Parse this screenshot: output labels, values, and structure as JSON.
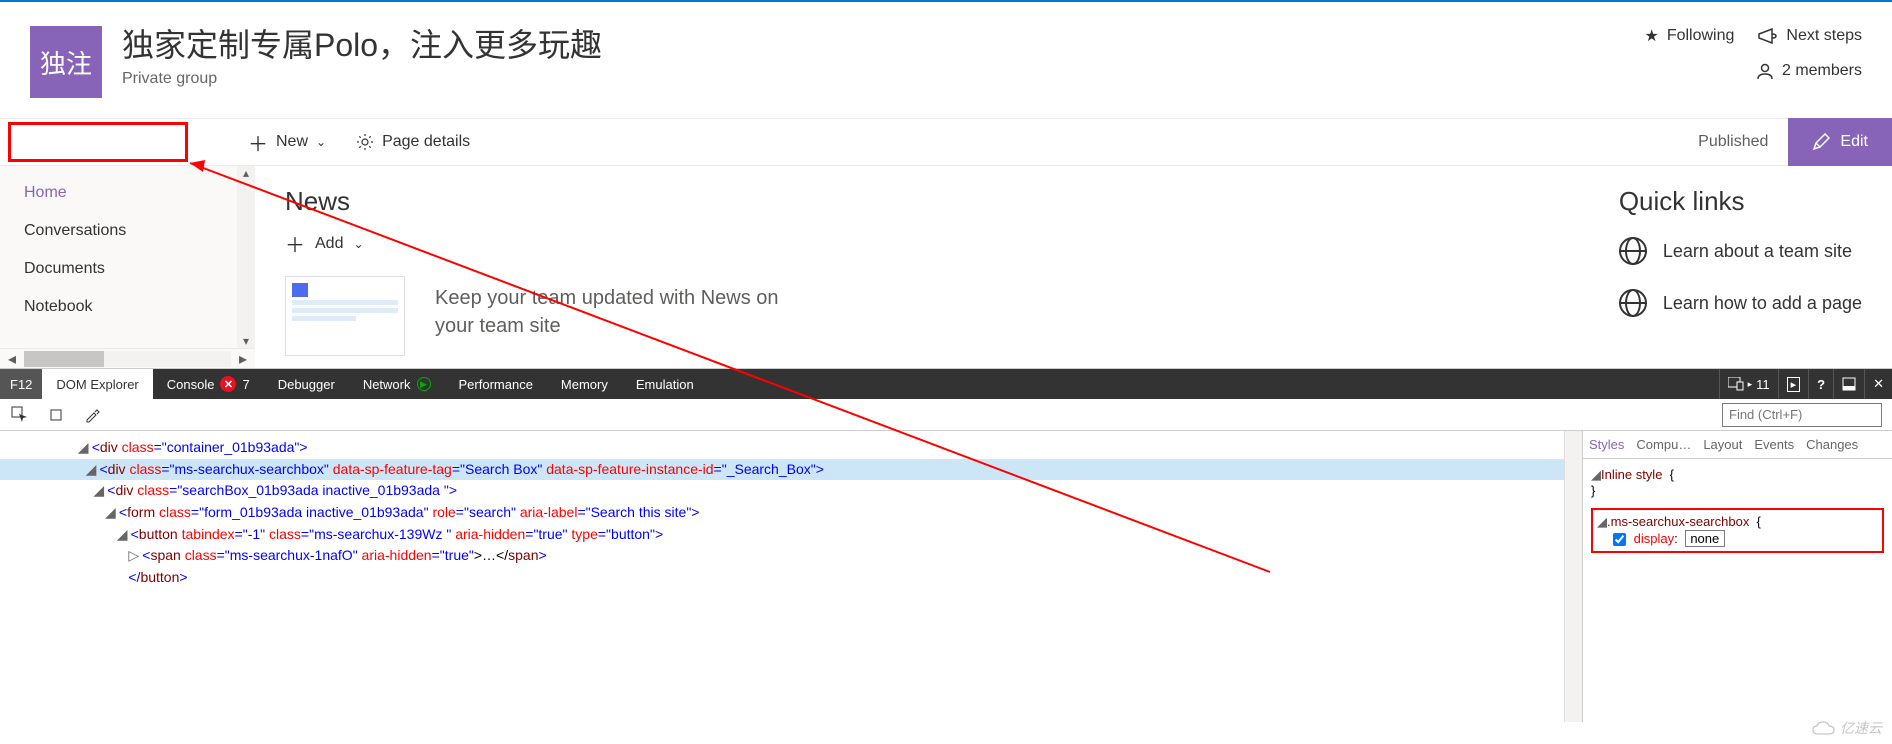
{
  "site": {
    "logo_text": "独注",
    "title": "独家定制专属Polo，注入更多玩趣",
    "subtitle": "Private group"
  },
  "header_actions": {
    "following": "Following",
    "next_steps": "Next steps",
    "members": "2 members"
  },
  "cmdbar": {
    "new": "New",
    "page_details": "Page details",
    "published": "Published",
    "edit": "Edit"
  },
  "nav": [
    "Home",
    "Conversations",
    "Documents",
    "Notebook"
  ],
  "news": {
    "heading": "News",
    "add": "Add",
    "desc_line1": "Keep your team updated with News on",
    "desc_line2": "your team site"
  },
  "quicklinks": {
    "heading": "Quick links",
    "items": [
      "Learn about a team site",
      "Learn how to add a page"
    ]
  },
  "devtools": {
    "tabs": {
      "f12": "F12",
      "dom": "DOM Explorer",
      "console": "Console",
      "console_err": "7",
      "debugger": "Debugger",
      "network": "Network",
      "performance": "Performance",
      "memory": "Memory",
      "emulation": "Emulation",
      "right_count": "11"
    },
    "find_placeholder": "Find (Ctrl+F)",
    "dom": {
      "l1_pre": "<div ",
      "l1_attr_class": "class",
      "l1_val_class": "container_01b93ada",
      "l1_post": ">",
      "l2_pre": "<div ",
      "l2_a1n": "class",
      "l2_a1v": "ms-searchux-searchbox",
      "l2_a2n": "data-sp-feature-tag",
      "l2_a2v": "Search Box",
      "l2_a3n": "data-sp-feature-instance-id",
      "l2_a3v": "_Search_Box",
      "l2_post": ">",
      "l3_pre": "<div ",
      "l3_a1n": "class",
      "l3_a1v": "searchBox_01b93ada inactive_01b93ada ",
      "l3_post": ">",
      "l4_pre": "<form ",
      "l4_a1n": "class",
      "l4_a1v": "form_01b93ada inactive_01b93ada",
      "l4_a2n": "role",
      "l4_a2v": "search",
      "l4_a3n": "aria-label",
      "l4_a3v": "Search this site",
      "l4_post": ">",
      "l5_pre": "<button ",
      "l5_a1n": "tabindex",
      "l5_a1v": "-1",
      "l5_a2n": "class",
      "l5_a2v": "ms-searchux-139Wz ",
      "l5_a3n": "aria-hidden",
      "l5_a3v": "true",
      "l5_a4n": "type",
      "l5_a4v": "button",
      "l5_post": ">",
      "l6_pre": "<span ",
      "l6_a1n": "class",
      "l6_a1v": "ms-searchux-1nafO",
      "l6_a2n": "aria-hidden",
      "l6_a2v": "true",
      "l6_mid": ">…</",
      "l6_post": "span>",
      "l7": "</button>"
    },
    "style_tabs": [
      "Styles",
      "Compu…",
      "Layout",
      "Events",
      "Changes"
    ],
    "styles": {
      "inline": "Inline style",
      "selector": ".ms-searchux-searchbox",
      "prop_name": "display",
      "prop_value": "none"
    }
  },
  "watermark": "亿速云"
}
